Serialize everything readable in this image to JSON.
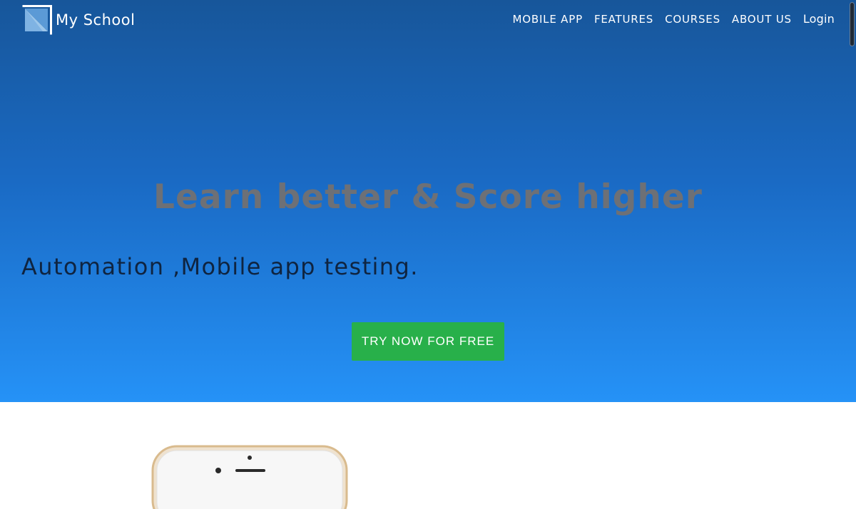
{
  "brand": {
    "name": "My School",
    "logo_icon": "school-logo-icon"
  },
  "nav": {
    "items": [
      {
        "label": "MOBILE APP"
      },
      {
        "label": "FEATURES"
      },
      {
        "label": "COURSES"
      },
      {
        "label": "ABOUT US"
      },
      {
        "label": "Login"
      }
    ]
  },
  "hero": {
    "headline": "Learn better & Score higher",
    "subline": "Automation ,Mobile app testing.",
    "cta_label": "TRY NOW FOR FREE"
  },
  "colors": {
    "hero_top": "#17569a",
    "hero_bottom": "#2592f7",
    "cta": "#28b04a",
    "headline": "#6d7076"
  },
  "icons": {
    "phone": "phone-mockup-icon",
    "scrollbar": "scrollbar-thumb"
  }
}
